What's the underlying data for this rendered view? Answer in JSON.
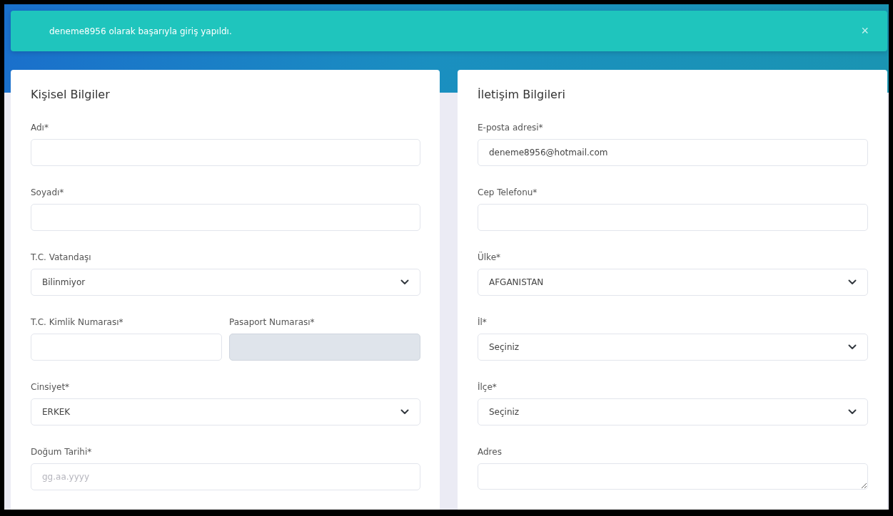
{
  "alert": {
    "message": "deneme8956 olarak başarıyla giriş yapıldı.",
    "close": "×"
  },
  "cards": [
    {
      "title": "Kişisel Bilgiler",
      "fields": [
        {
          "kind": "text",
          "label": "Adı*",
          "disabled": false
        },
        {
          "kind": "text",
          "label": "Soyadı*",
          "disabled": false
        },
        {
          "kind": "select",
          "label": "T.C. Vatandaşı",
          "value": "Bilinmiyor",
          "disabled": false
        },
        {
          "kind": "pair",
          "fields": [
            {
              "label": "T.C. Kimlik Numarası*",
              "disabled": false
            },
            {
              "label": "Pasaport Numarası*",
              "disabled": true
            }
          ]
        },
        {
          "kind": "select",
          "label": "Cinsiyet*",
          "value": "ERKEK",
          "disabled": false
        },
        {
          "kind": "text",
          "label": "Doğum Tarihi*",
          "placeholder": "gg.aa.yyyy",
          "disabled": false
        }
      ]
    },
    {
      "title": "İletişim Bilgileri",
      "fields": [
        {
          "kind": "text",
          "label": "E-posta adresi*",
          "value": "deneme8956@hotmail.com",
          "disabled": false
        },
        {
          "kind": "text",
          "label": "Cep Telefonu*",
          "disabled": false
        },
        {
          "kind": "select",
          "label": "Ülke*",
          "value": "AFGANISTAN",
          "disabled": false
        },
        {
          "kind": "select",
          "label": "İl*",
          "value": "Seçiniz",
          "disabled": false
        },
        {
          "kind": "select",
          "label": "İlçe*",
          "value": "Seçiniz",
          "disabled": false
        },
        {
          "kind": "textarea",
          "label": "Adres",
          "disabled": false
        }
      ]
    }
  ]
}
